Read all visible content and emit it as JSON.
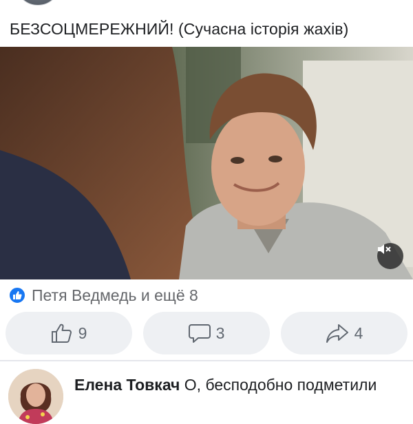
{
  "post": {
    "title": "БЕЗСОЦМЕРЕЖНИЙ! (Сучасна історія жахів)"
  },
  "video": {
    "mute_icon": "speaker-muted-icon"
  },
  "reactions": {
    "icon": "like-icon",
    "text": "Петя Ведмедь и ещё 8"
  },
  "actions": {
    "like_count": "9",
    "comment_count": "3",
    "share_count": "4"
  },
  "comment": {
    "author": "Елена Товкач",
    "text": "О, бесподобно подметили"
  },
  "colors": {
    "accent": "#1877f2",
    "button_bg": "#eef0f3",
    "muted_text": "#65676b"
  }
}
